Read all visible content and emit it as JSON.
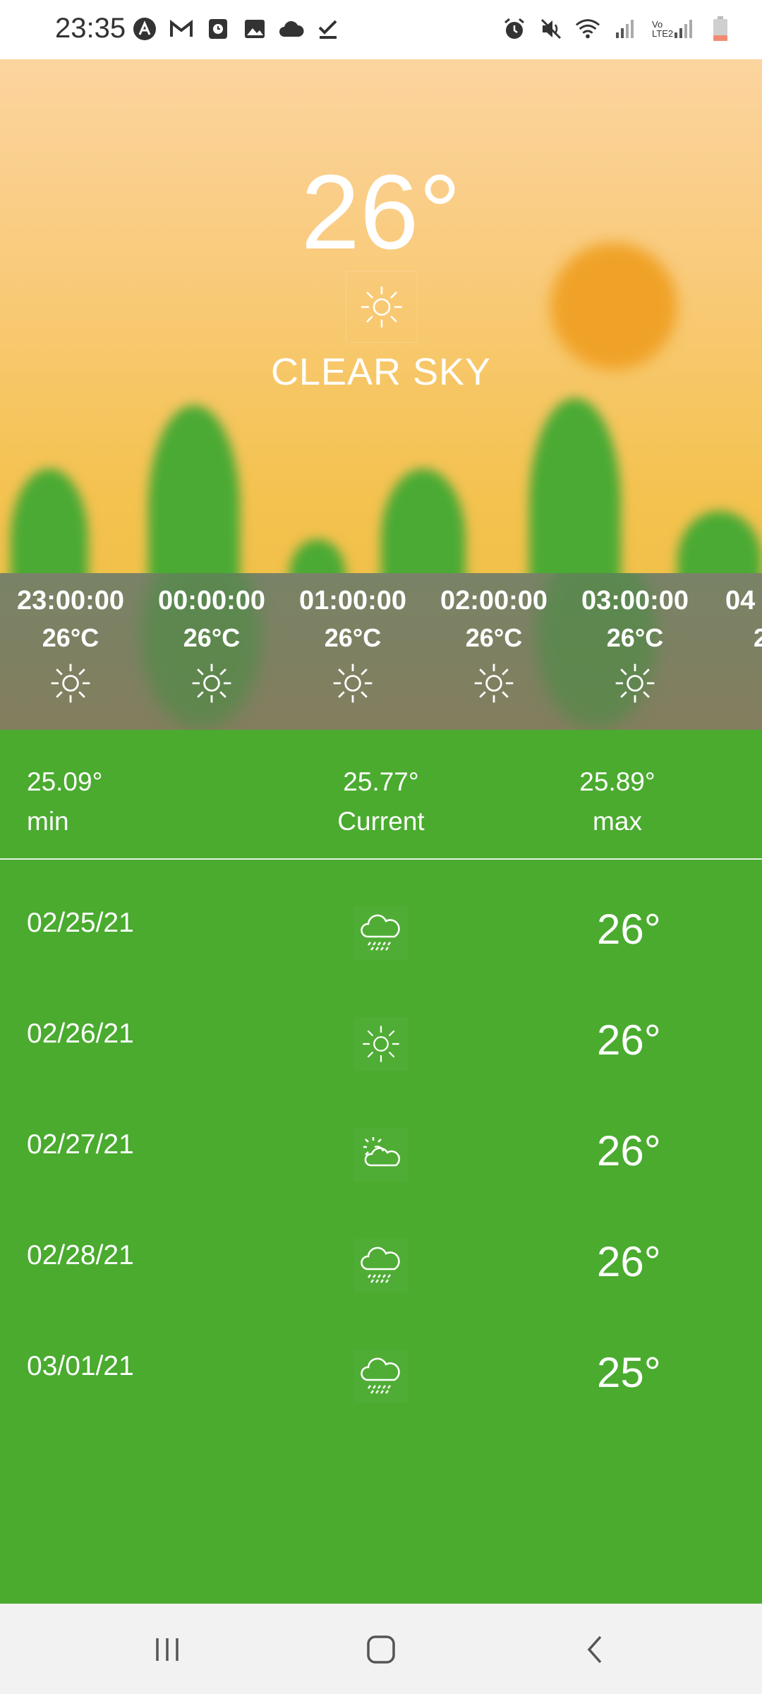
{
  "status": {
    "time": "23:35",
    "left_icons": [
      "app-a-icon",
      "mail-icon",
      "clock-app-icon",
      "gallery-icon",
      "cloud-icon",
      "check-icon"
    ],
    "right_icons": [
      "alarm-icon",
      "mute-icon",
      "wifi-icon",
      "signal-icon",
      "volte-signal-icon",
      "battery-icon"
    ],
    "volte_label": "Vo LTE2"
  },
  "current": {
    "temperature": "26°",
    "condition": "CLEAR SKY",
    "icon": "sun-icon"
  },
  "hourly": [
    {
      "time": "23:00:00",
      "temp": "26°C",
      "icon": "sun-icon"
    },
    {
      "time": "00:00:00",
      "temp": "26°C",
      "icon": "sun-icon"
    },
    {
      "time": "01:00:00",
      "temp": "26°C",
      "icon": "sun-icon"
    },
    {
      "time": "02:00:00",
      "temp": "26°C",
      "icon": "sun-icon"
    },
    {
      "time": "03:00:00",
      "temp": "26°C",
      "icon": "sun-icon"
    },
    {
      "time": "04",
      "temp": "2",
      "icon": "sun-icon"
    }
  ],
  "summary": {
    "min_value": "25.09°",
    "min_label": "min",
    "current_value": "25.77°",
    "current_label": "Current",
    "max_value": "25.89°",
    "max_label": "max"
  },
  "forecast": [
    {
      "date": "02/25/21",
      "icon": "rain-cloud-icon",
      "temp": "26°"
    },
    {
      "date": "02/26/21",
      "icon": "sun-icon",
      "temp": "26°"
    },
    {
      "date": "02/27/21",
      "icon": "partly-cloudy-icon",
      "temp": "26°"
    },
    {
      "date": "02/28/21",
      "icon": "rain-cloud-icon",
      "temp": "26°"
    },
    {
      "date": "03/01/21",
      "icon": "rain-cloud-icon",
      "temp": "25°"
    }
  ],
  "colors": {
    "main_green": "#4aab2f",
    "hero_top": "#fcd49f",
    "hero_bottom": "#f1c14a",
    "sun": "#f0a228"
  },
  "nav": {
    "recents": "recents-icon",
    "home": "home-icon",
    "back": "back-icon"
  }
}
